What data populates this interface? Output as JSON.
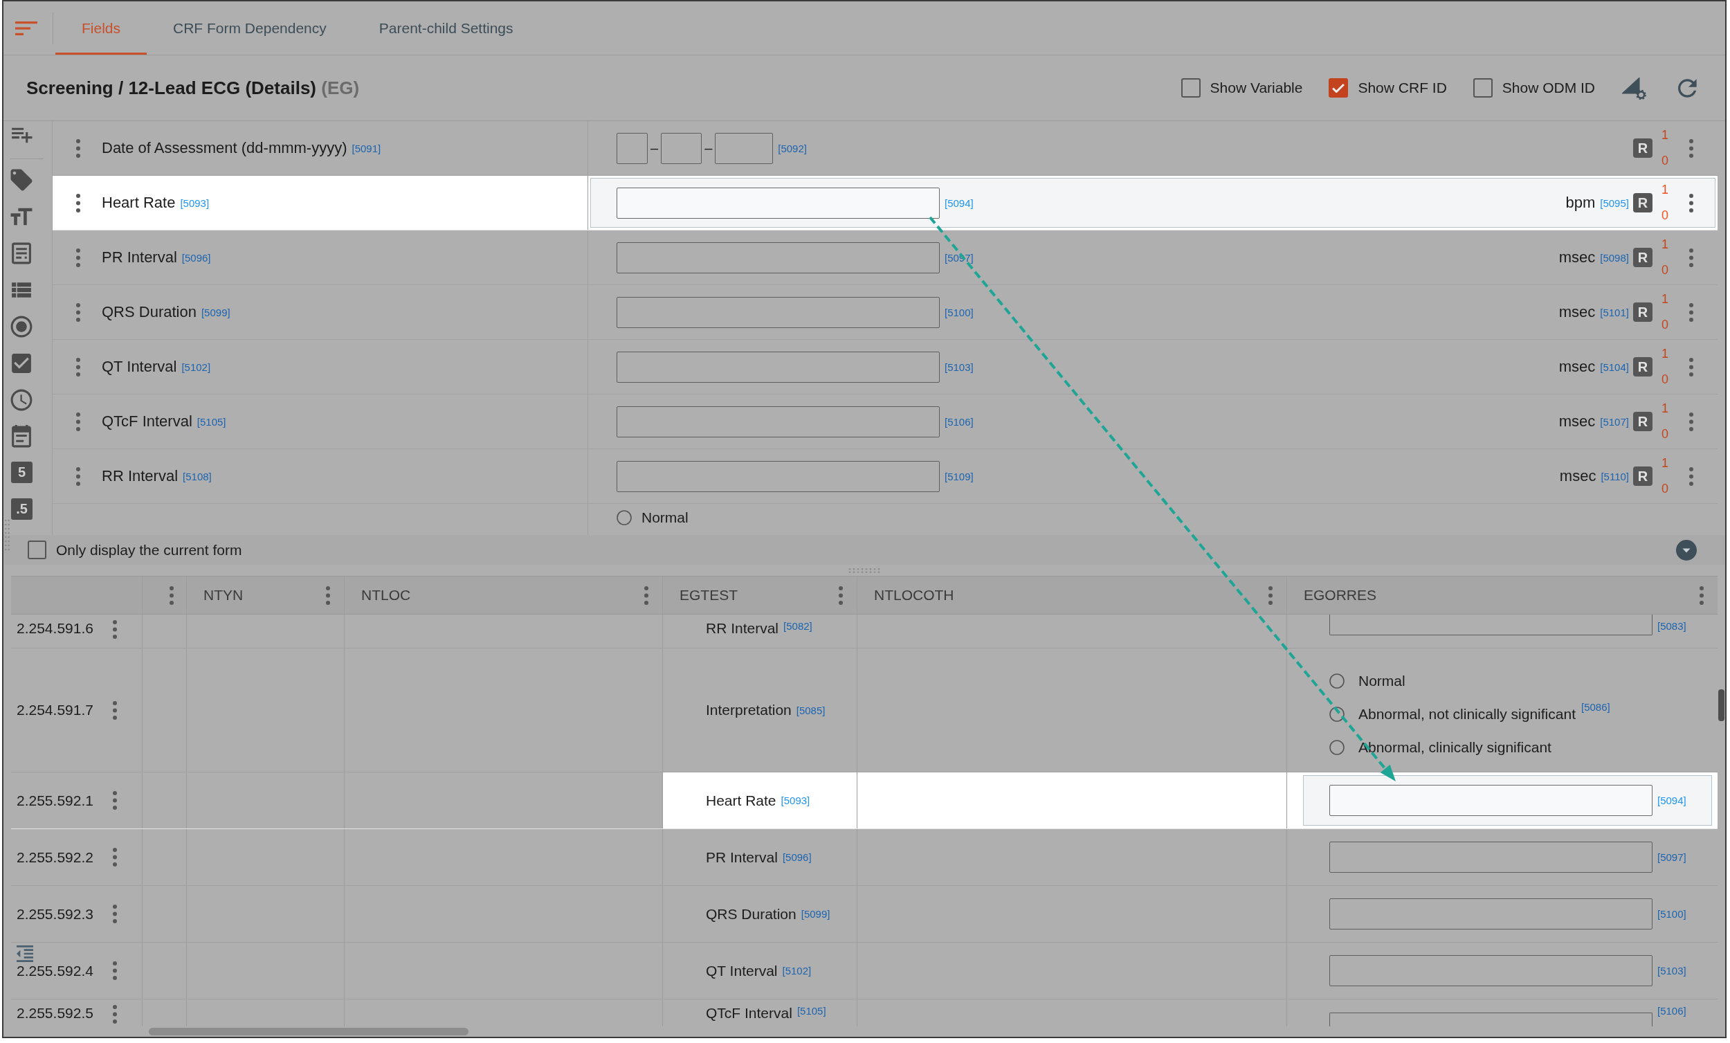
{
  "tabs": [
    {
      "label": "Fields",
      "selected": true
    },
    {
      "label": "CRF Form Dependency",
      "selected": false
    },
    {
      "label": "Parent-child Settings",
      "selected": false
    }
  ],
  "form_header": {
    "title": "Screening / 12-Lead ECG (Details)",
    "domain": "(EG)",
    "toggles": [
      {
        "label": "Show Variable",
        "checked": false
      },
      {
        "label": "Show CRF ID",
        "checked": true
      },
      {
        "label": "Show ODM ID",
        "checked": false
      }
    ]
  },
  "field_toolbar": {
    "number_tools": [
      "5",
      ".5"
    ]
  },
  "fields": [
    {
      "kind": "date",
      "label": "Date of Assessment (dd-mmm-yyyy)",
      "crf_id": "[5091]",
      "separators": [
        "–",
        "–"
      ],
      "input_id": "[5092]",
      "badge": "R",
      "counts": [
        "1",
        "0"
      ],
      "selected": false
    },
    {
      "kind": "number",
      "label": "Heart Rate",
      "crf_id": "[5093]",
      "input_id": "[5094]",
      "unit": "bpm",
      "unit_id": "[5095]",
      "badge": "R",
      "counts": [
        "1",
        "0"
      ],
      "selected": true
    },
    {
      "kind": "number",
      "label": "PR Interval",
      "crf_id": "[5096]",
      "input_id": "[5097]",
      "unit": "msec",
      "unit_id": "[5098]",
      "badge": "R",
      "counts": [
        "1",
        "0"
      ],
      "selected": false
    },
    {
      "kind": "number",
      "label": "QRS Duration",
      "crf_id": "[5099]",
      "input_id": "[5100]",
      "unit": "msec",
      "unit_id": "[5101]",
      "badge": "R",
      "counts": [
        "1",
        "0"
      ],
      "selected": false
    },
    {
      "kind": "number",
      "label": "QT Interval",
      "crf_id": "[5102]",
      "input_id": "[5103]",
      "unit": "msec",
      "unit_id": "[5104]",
      "badge": "R",
      "counts": [
        "1",
        "0"
      ],
      "selected": false
    },
    {
      "kind": "number",
      "label": "QTcF Interval",
      "crf_id": "[5105]",
      "input_id": "[5106]",
      "unit": "msec",
      "unit_id": "[5107]",
      "badge": "R",
      "counts": [
        "1",
        "0"
      ],
      "selected": false
    },
    {
      "kind": "number",
      "label": "RR Interval",
      "crf_id": "[5108]",
      "input_id": "[5109]",
      "unit": "msec",
      "unit_id": "[5110]",
      "badge": "R",
      "counts": [
        "1",
        "0"
      ],
      "selected": false
    },
    {
      "kind": "radio",
      "options": [
        {
          "label": "Normal",
          "selected": false
        }
      ],
      "selected": false
    }
  ],
  "current_form_filter": {
    "label": "Only display the current form",
    "checked": false
  },
  "grid": {
    "columns": [
      "NTYN",
      "NTLOC",
      "EGTEST",
      "NTLOCOTH",
      "EGORRES"
    ],
    "rows": [
      {
        "row_number": "2.254.591.6",
        "egtest": {
          "label": "RR Interval",
          "crf_id": "[5082]"
        },
        "egorres": {
          "kind": "text",
          "input_id": "[5083]"
        },
        "selected": false
      },
      {
        "row_number": "2.254.591.7",
        "egtest": {
          "label": "Interpretation",
          "crf_id": "[5085]"
        },
        "egorres": {
          "kind": "radio",
          "options": [
            {
              "label": "Normal",
              "selected": false
            },
            {
              "label": "Abnormal, not clinically significant",
              "crf_id": "[5086]",
              "selected": false
            },
            {
              "label": "Abnormal, clinically significant",
              "selected": false
            }
          ]
        },
        "selected": false
      },
      {
        "row_number": "2.255.592.1",
        "egtest": {
          "label": "Heart Rate",
          "crf_id": "[5093]"
        },
        "egorres": {
          "kind": "text",
          "input_id": "[5094]"
        },
        "selected": true
      },
      {
        "row_number": "2.255.592.2",
        "egtest": {
          "label": "PR Interval",
          "crf_id": "[5096]"
        },
        "egorres": {
          "kind": "text",
          "input_id": "[5097]"
        },
        "selected": false
      },
      {
        "row_number": "2.255.592.3",
        "egtest": {
          "label": "QRS Duration",
          "crf_id": "[5099]"
        },
        "egorres": {
          "kind": "text",
          "input_id": "[5100]"
        },
        "selected": false
      },
      {
        "row_number": "2.255.592.4",
        "egtest": {
          "label": "QT Interval",
          "crf_id": "[5102]"
        },
        "egorres": {
          "kind": "text",
          "input_id": "[5103]"
        },
        "selected": false
      },
      {
        "row_number": "2.255.592.5",
        "egtest": {
          "label": "QTcF Interval",
          "crf_id": "[5105]"
        },
        "egorres": {
          "kind": "text",
          "input_id": "[5106]"
        },
        "selected": false
      }
    ]
  }
}
